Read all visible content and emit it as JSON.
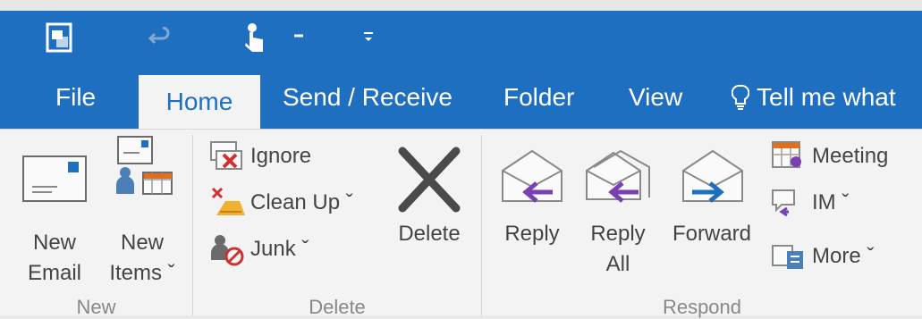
{
  "qat": {
    "items": [
      "app-icon",
      "undo-icon",
      "touch-mode-icon",
      "dropdown-icon",
      "customize-icon"
    ]
  },
  "tabs": [
    {
      "label": "File"
    },
    {
      "label": "Home"
    },
    {
      "label": "Send / Receive"
    },
    {
      "label": "Folder"
    },
    {
      "label": "View"
    },
    {
      "label": "Tell me what"
    }
  ],
  "groups": {
    "new": {
      "name": "New",
      "new_email": {
        "line1": "New",
        "line2": "Email"
      },
      "new_items": {
        "line1": "New",
        "line2": "Items ˇ"
      }
    },
    "delete": {
      "name": "Delete",
      "ignore": "Ignore",
      "cleanup": "Clean Up ˇ",
      "junk": "Junk ˇ",
      "delete": "Delete"
    },
    "respond": {
      "name": "Respond",
      "reply": "Reply",
      "reply_all": {
        "line1": "Reply",
        "line2": "All"
      },
      "forward": "Forward",
      "meeting": "Meeting",
      "im": "IM ˇ",
      "more": "More ˇ"
    }
  },
  "colors": {
    "accent": "#1f6fc0",
    "ribbon_bg": "#f3f3f3",
    "reply_arrow": "#7b3fb4",
    "forward_arrow": "#1f6fc0"
  }
}
